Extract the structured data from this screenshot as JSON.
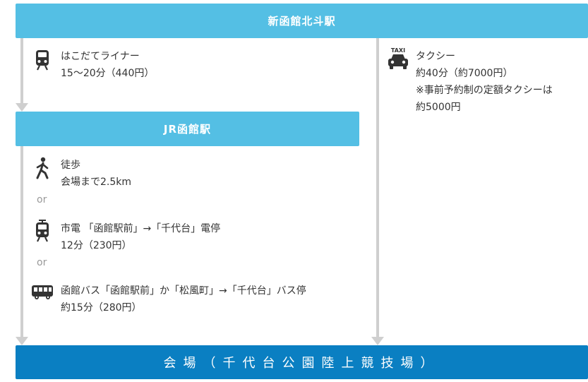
{
  "stations": {
    "top": "新函館北斗駅",
    "middle": "JR函館駅",
    "bottom": "会場（千代台公園陸上競技場）"
  },
  "routes": {
    "liner": {
      "name": "はこだてライナー",
      "detail": "15〜20分（440円）"
    },
    "taxi": {
      "name": "タクシー",
      "detail": "約40分（約7000円）",
      "note1": "※事前予約制の定額タクシーは",
      "note2": "約5000円",
      "badge": "TAXI"
    },
    "walk": {
      "name": "徒歩",
      "detail": "会場まで2.5km"
    },
    "tram": {
      "name": "市電 「函館駅前」→「千代台」電停",
      "detail": "12分（230円）"
    },
    "bus": {
      "name": "函館バス「函館駅前」か「松風町」→「千代台」バス停",
      "detail": "約15分（280円）"
    }
  },
  "separators": {
    "or1": "or",
    "or2": "or"
  },
  "icons": [
    "train-icon",
    "taxi-icon",
    "walking-person-icon",
    "tram-icon",
    "bus-icon"
  ]
}
